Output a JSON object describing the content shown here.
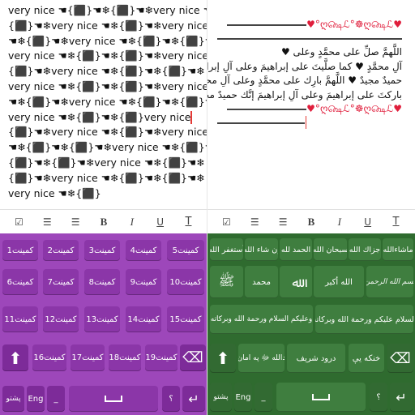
{
  "left_editor": {
    "lines": [
      "very nice ☚{⬛}☚❄{⬛}☚❄very nice ☚",
      "{⬛}☚❄very nice ☚❄{⬛}☚❄very nice",
      "☚❄{⬛}☚❄very nice ☚❄{⬛}☚❄{⬛}☚",
      "very nice ☚❄{⬛}☚❄{⬛}☚❄very nice",
      "{⬛}☚❄very nice ☚❄{⬛}☚❄{⬛}☚❄",
      "very nice ☚❄{⬛}☚❄{⬛}☚❄very nice",
      "☚❄{⬛}☚❄very nice ☚❄{⬛}☚❄{⬛}☚",
      "very nice ☚❄{⬛}☚❄{⬛}very nice",
      "{⬛}☚❄very nice ☚❄{⬛}☚❄very nice",
      "☚❄{⬛}☚❄{⬛}☚❄very nice ☚❄{⬛}☚",
      "{⬛}☚❄{⬛}☚❄very nice ☚❄{⬛}☚❄",
      "{⬛}☚❄very nice ☚❄{⬛}☚❄{⬛}☚❄",
      "very nice ☚❄{⬛}"
    ]
  },
  "right_editor": {
    "decor_line": "♥︎ღ௸ℒ°☸ღ௸ℒ°♥︎",
    "lines": [
      "اللَّهمَّ صلِّ على محمَّدٍ وعلى ♥︎",
      "آلِ محمَّدٍ ♥︎ كما صلَّيتَ على إبراهيمَ وعلى آلِ إبراهيمَ إنَّك",
      "حميدٌ مجيدٌ ♥︎ اللَّهمَّ بارِك على محمَّدٍ وعلى آلِ محمَّدٍ ♥︎ كما",
      "باركتَ على إبراهيمَ وعلى آلِ إبراهيمَ إنَّك حميدٌ مجيدٌ",
      "♥︎ღ௸ℒ°☸ღ௸ℒ°♥︎"
    ]
  },
  "toolbar": {
    "checkbox": "☑",
    "numbered_list": "☰",
    "bullet_list": "☰",
    "bold": "B",
    "italic": "I",
    "underline": "U",
    "text_color": "T"
  },
  "left_keyboard": {
    "row1": [
      "كمينت1",
      "كمينت2",
      "كمينت3",
      "كمينت4",
      "كمينت5"
    ],
    "row2": [
      "كمينت6",
      "كمينت7",
      "كمينت8",
      "كمينت9",
      "كمينت10"
    ],
    "row3": [
      "كمينت11",
      "كمينت12",
      "كمينت13",
      "كمينت14",
      "كمينت15"
    ],
    "row4": [
      "كمينت16",
      "كمينت17",
      "كمينت18",
      "كمينت19"
    ],
    "row5": {
      "lang": "پشتو",
      "eng": "Eng",
      "dash": "_",
      "q": "؟",
      "dot": "."
    },
    "shift": "⬆",
    "backspace": "⌫",
    "enter": "↵"
  },
  "right_keyboard": {
    "row1": [
      "ماشاءالله",
      "جزاك الله",
      "سبحان الله",
      "الحمد لله",
      "إن شاء الله",
      "أستغفر الله"
    ],
    "row2": [
      "بسم الله الرحمن",
      "الله أكبر",
      "ﷲ",
      "محمد",
      "ﷺ"
    ],
    "row3": [
      "السلام عليكم ورحمة الله وبركاته",
      "وعليكم السلام ورحمة الله وبركاته"
    ],
    "row4": [
      "خنكه یې",
      "درود شريف",
      "دالله ﷻ په امان"
    ],
    "row5": {
      "lang": "پشتو",
      "eng": "Eng",
      "dash": "_",
      "q": "؟",
      "dot": "."
    },
    "shift": "⬆",
    "backspace": "⌫",
    "enter": "↵"
  },
  "colors": {
    "left_keyboard_bg": "#9d47ba",
    "right_keyboard_bg": "#2f6b2f",
    "heart": "#e01e3c",
    "cursor": "#e53935"
  }
}
